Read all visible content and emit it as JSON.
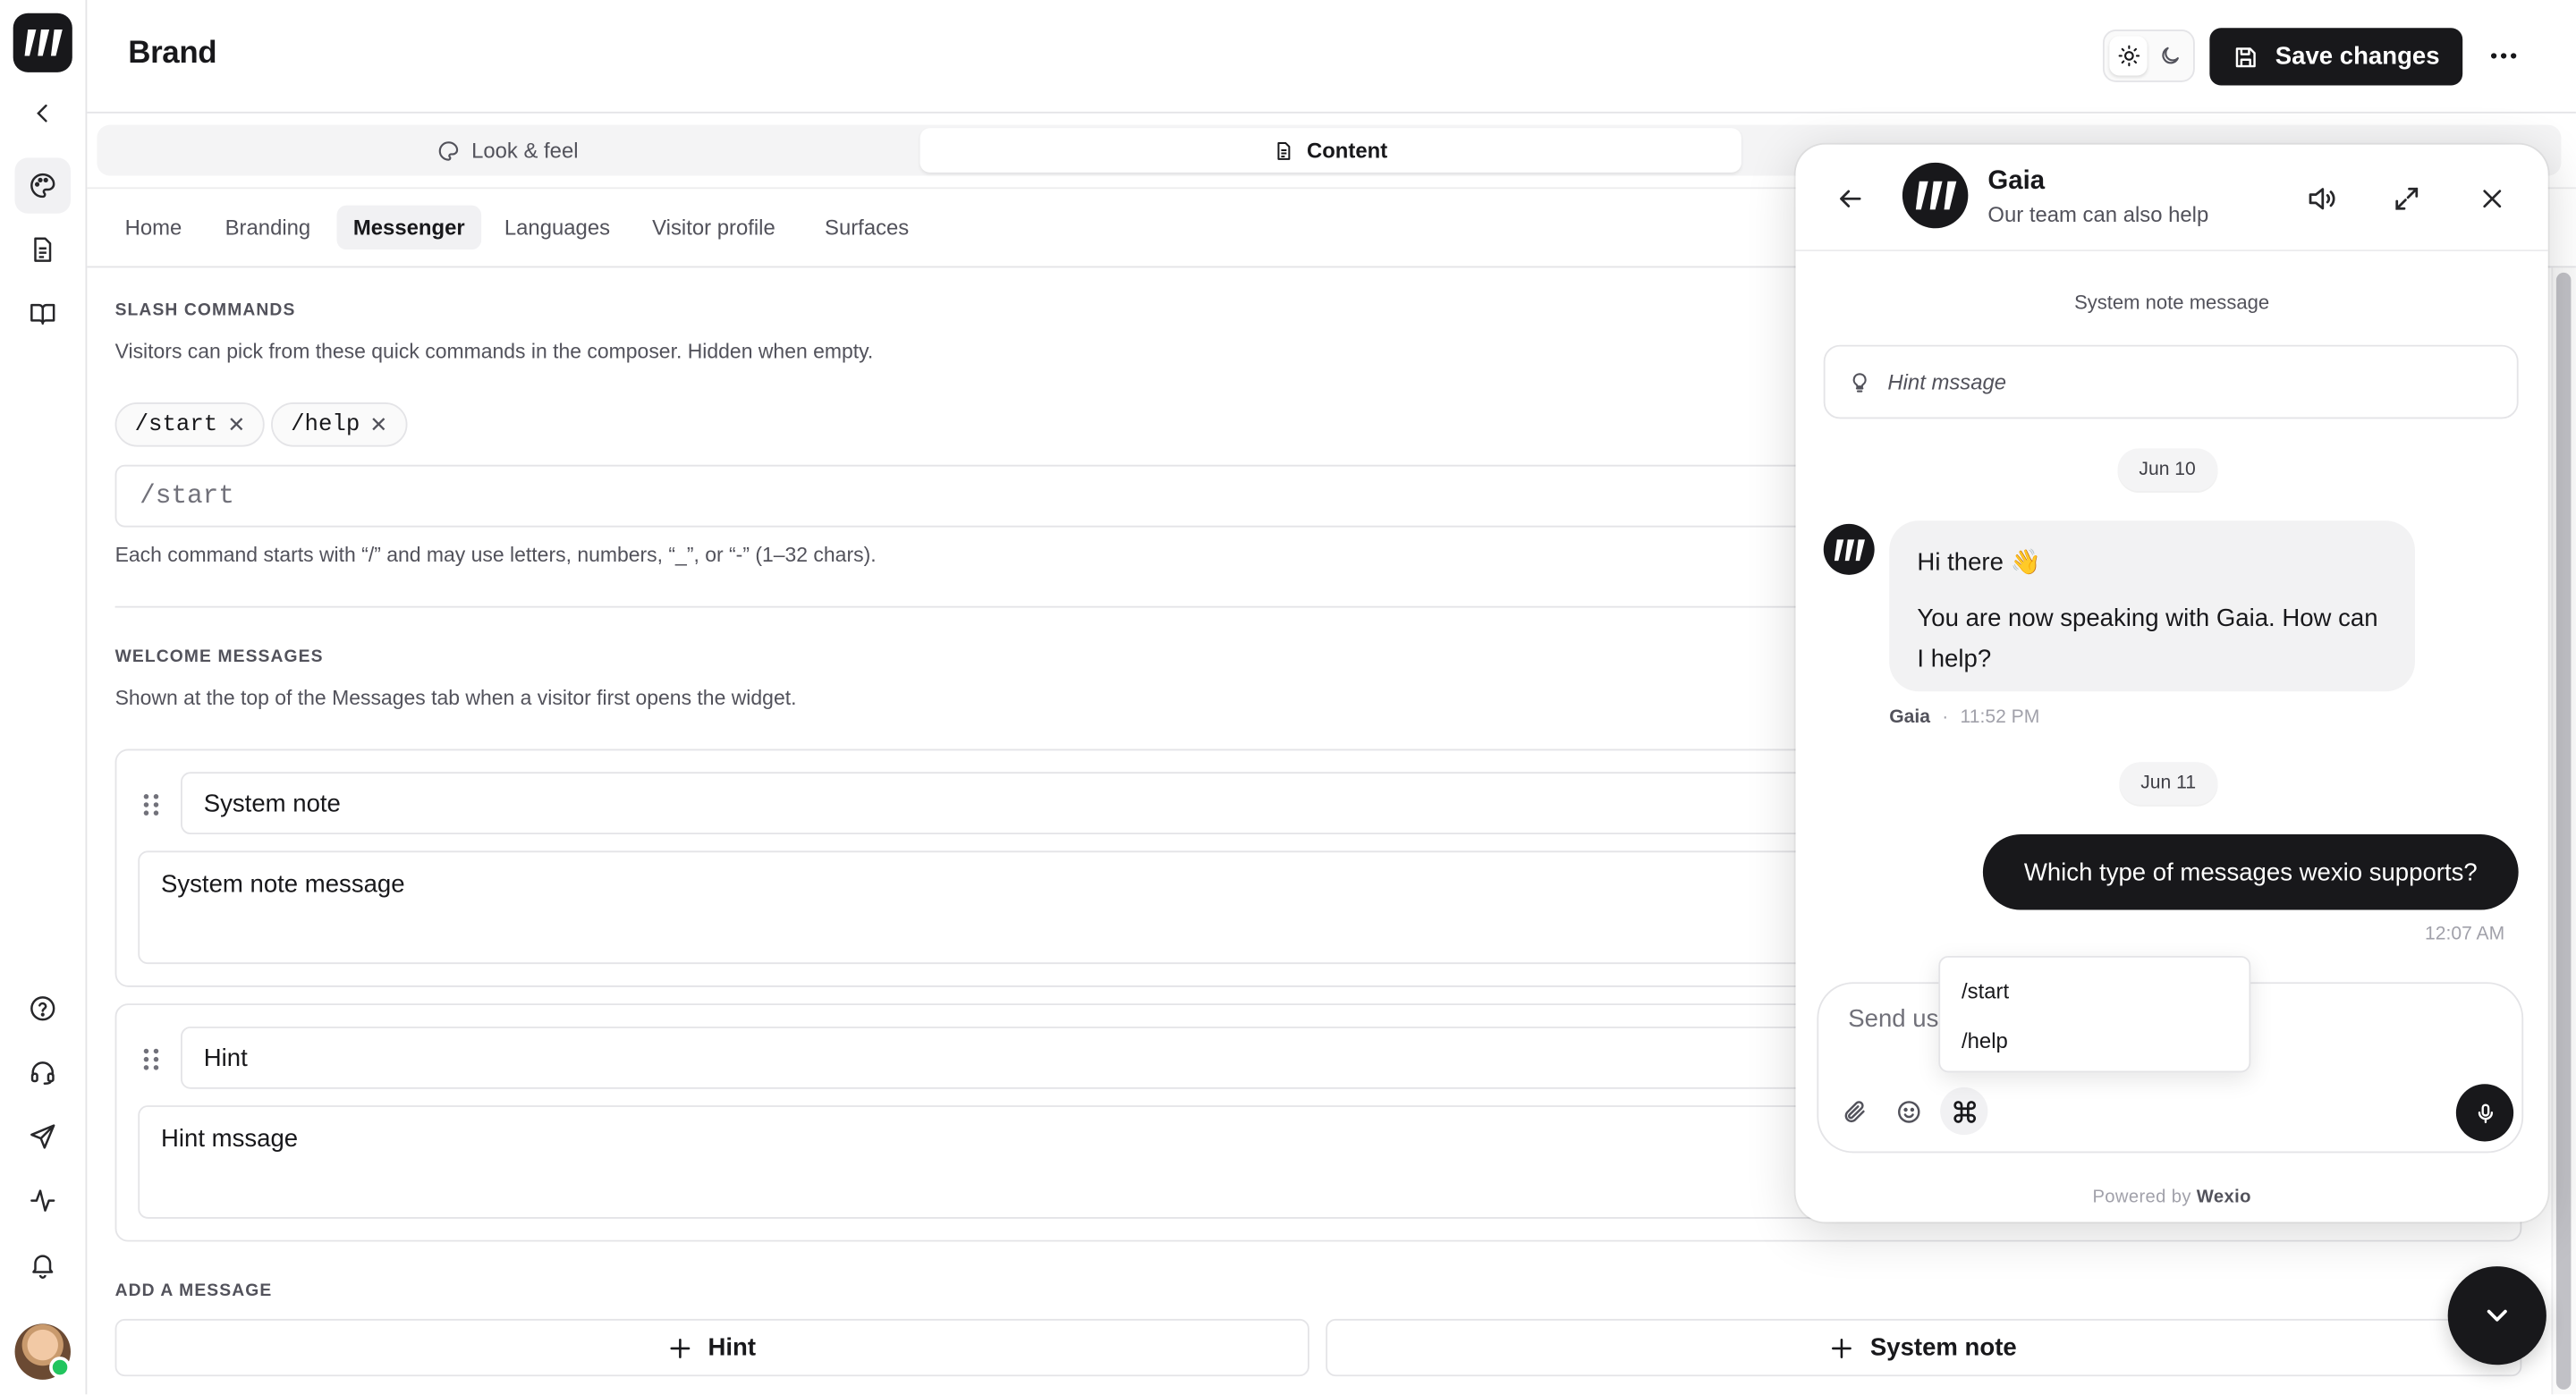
{
  "header": {
    "title": "Brand",
    "save_label": "Save changes"
  },
  "top_tabs": [
    {
      "label": "Look & feel",
      "icon": "palette-icon"
    },
    {
      "label": "Content",
      "icon": "file-text-icon"
    }
  ],
  "sub_tabs": [
    "Home",
    "Branding",
    "Messenger",
    "Languages",
    "Visitor profile",
    "Surfaces"
  ],
  "slash_commands": {
    "heading": "SLASH COMMANDS",
    "description": "Visitors can pick from these quick commands in the composer. Hidden when empty.",
    "chips": [
      "/start",
      "/help"
    ],
    "input_value": "/start",
    "help_text": "Each command starts with “/” and may use letters, numbers, “_”, or “-” (1–32 chars)."
  },
  "welcome_messages": {
    "heading": "WELCOME MESSAGES",
    "description": "Shown at the top of the Messages tab when a visitor first opens the widget.",
    "items": [
      {
        "title": "System note",
        "body": "System note message"
      },
      {
        "title": "Hint",
        "body": "Hint mssage"
      }
    ]
  },
  "add_message": {
    "heading": "ADD A MESSAGE",
    "hint_label": "Hint",
    "system_note_label": "System note"
  },
  "chat": {
    "agent_name": "Gaia",
    "subtitle": "Our team can also help",
    "system_note": "System note message",
    "hint": "Hint mssage",
    "date1": "Jun 10",
    "greeting": "Hi there 👋",
    "message": "You are now speaking with Gaia. How can I help?",
    "meta_name": "Gaia",
    "meta_sep": "·",
    "meta_time": "11:52 PM",
    "date2": "Jun 11",
    "user_message": "Which type of messages wexio supports?",
    "user_time": "12:07 AM",
    "composer_placeholder": "Send us",
    "powered_by": "Powered by",
    "brand": "Wexio"
  },
  "command_popup": [
    "/start",
    "/help"
  ],
  "colors": {
    "accent": "#18181b",
    "online": "#22c55e",
    "border": "#e4e4e7"
  }
}
